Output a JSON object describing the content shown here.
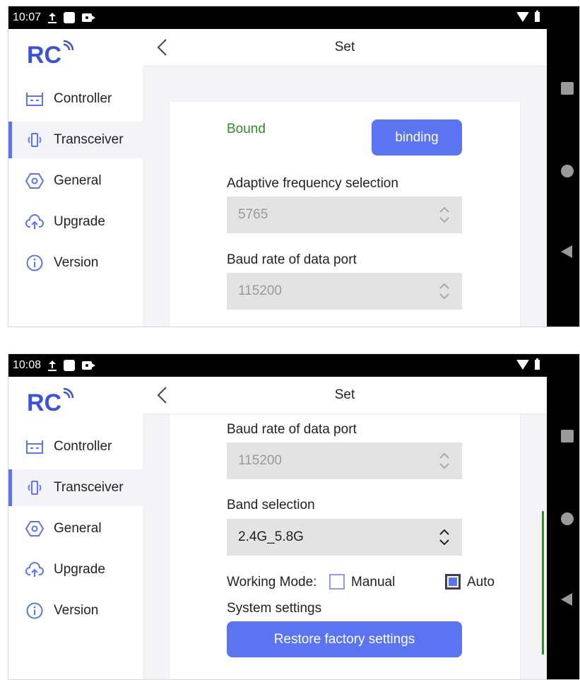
{
  "screens": [
    {
      "time": "10:07",
      "sidebar": {
        "logo_text": "RC",
        "items": [
          {
            "label": "Controller",
            "icon": "controller-icon",
            "active": false
          },
          {
            "label": "Transceiver",
            "icon": "transceiver-icon",
            "active": true
          },
          {
            "label": "General",
            "icon": "general-icon",
            "active": false
          },
          {
            "label": "Upgrade",
            "icon": "upgrade-icon",
            "active": false
          },
          {
            "label": "Version",
            "icon": "version-icon",
            "active": false
          }
        ]
      },
      "header": {
        "title": "Set"
      },
      "content": {
        "status": "Bound",
        "binding_button": "binding",
        "adaptive_label": "Adaptive frequency selection",
        "adaptive_value": "5765",
        "baud_label": "Baud rate of data port",
        "baud_value": "115200"
      }
    },
    {
      "time": "10:08",
      "sidebar": {
        "logo_text": "RC",
        "items": [
          {
            "label": "Controller",
            "icon": "controller-icon",
            "active": false
          },
          {
            "label": "Transceiver",
            "icon": "transceiver-icon",
            "active": true
          },
          {
            "label": "General",
            "icon": "general-icon",
            "active": false
          },
          {
            "label": "Upgrade",
            "icon": "upgrade-icon",
            "active": false
          },
          {
            "label": "Version",
            "icon": "version-icon",
            "active": false
          }
        ]
      },
      "header": {
        "title": "Set"
      },
      "content": {
        "baud_label": "Baud rate of data port",
        "baud_value": "115200",
        "band_label": "Band selection",
        "band_value": "2.4G_5.8G",
        "working_mode_label": "Working Mode:",
        "mode_manual": "Manual",
        "mode_auto": "Auto",
        "manual_checked": false,
        "auto_checked": true,
        "system_label": "System settings",
        "restore_button": "Restore factory settings"
      }
    }
  ],
  "colors": {
    "accent": "#5b74f0",
    "bound": "#2e8b2e",
    "select_bg": "#e3e3e3"
  }
}
